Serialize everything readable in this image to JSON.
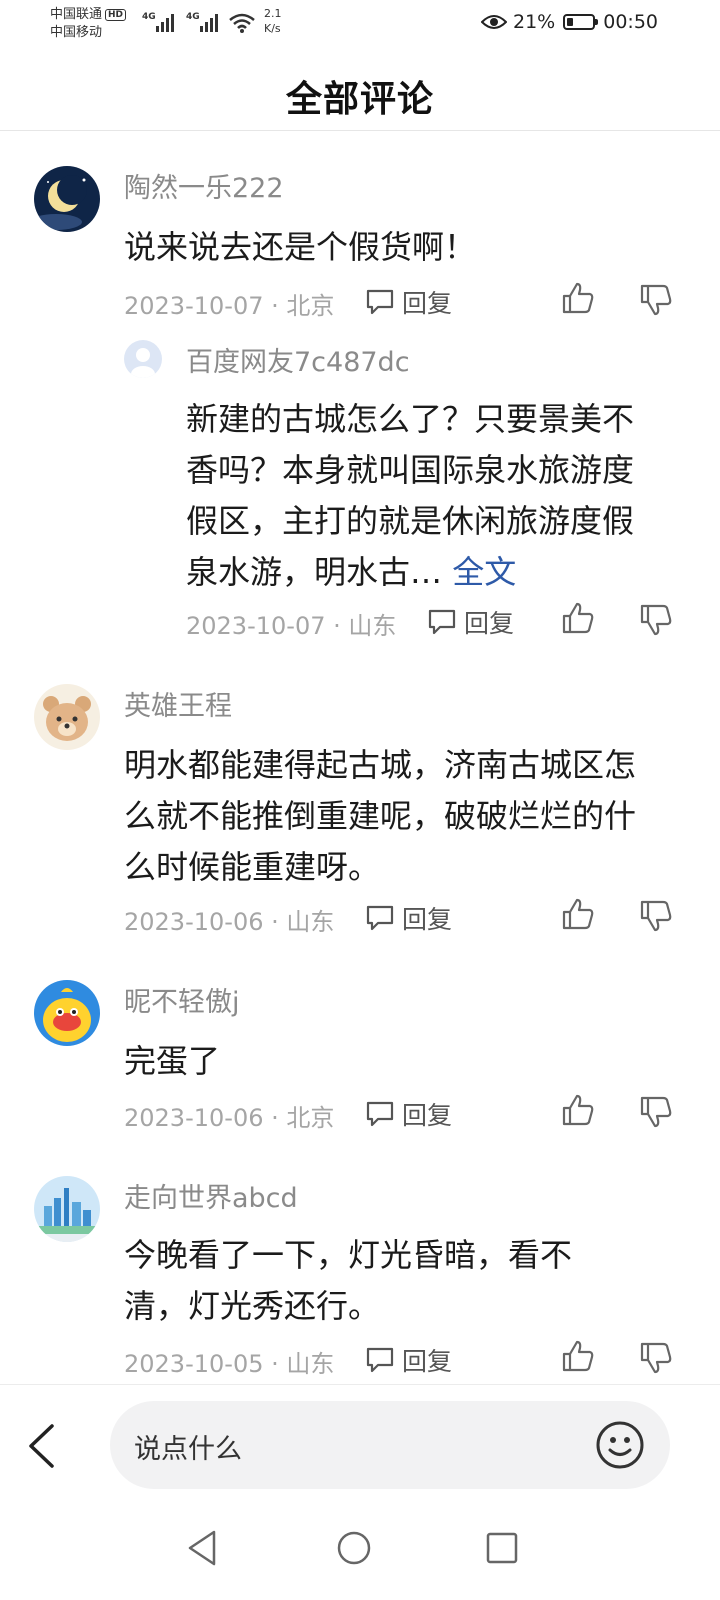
{
  "status": {
    "carrier1": "中国联通",
    "carrier1_badge": "HD",
    "carrier2": "中国移动",
    "net1": "4G",
    "net2": "4G",
    "speed_value": "2.1",
    "speed_unit": "K/s",
    "battery": "21%",
    "time": "00:50"
  },
  "header": {
    "title": "全部评论"
  },
  "reply_label": "回复",
  "comments": [
    {
      "user": "陶然一乐222",
      "text": "说来说去还是个假货啊！",
      "date": "2023-10-07 · 北京",
      "reply": {
        "user": "百度网友7c487dc",
        "text": "新建的古城怎么了？只要景美不香吗？本身就叫国际泉水旅游度假区，主打的就是休闲旅游度假泉水游，明水古…",
        "full_link": "全文",
        "date": "2023-10-07 · 山东"
      }
    },
    {
      "user": "英雄王程",
      "text": "明水都能建得起古城，济南古城区怎么就不能推倒重建呢，破破烂烂的什么时候能重建呀。",
      "date": "2023-10-06 · 山东"
    },
    {
      "user": "昵不轻傲j",
      "text": "完蛋了",
      "date": "2023-10-06 · 北京"
    },
    {
      "user": "走向世界abcd",
      "text": "今晚看了一下，灯光昏暗，看不清，灯光秀还行。",
      "date": "2023-10-05 · 山东"
    }
  ],
  "input": {
    "placeholder": "说点什么"
  },
  "icons": {
    "back": "back-arrow-icon",
    "emoji": "smiley-icon",
    "like": "thumbs-up-icon",
    "dislike": "thumbs-down-icon",
    "reply": "speech-bubble-icon"
  },
  "colors": {
    "link": "#2e5aa8",
    "meta": "#a5a5a5",
    "username": "#8a8a8a"
  }
}
